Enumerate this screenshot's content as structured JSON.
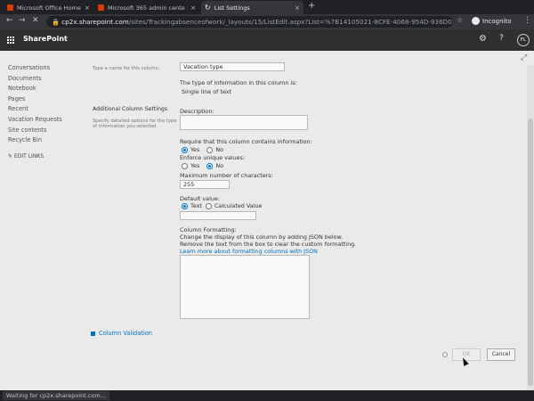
{
  "browser": {
    "tabs": [
      {
        "title": "Microsoft Office Home",
        "icon": "office-favicon",
        "color": "#d83b01"
      },
      {
        "title": "Microsoft 365 admin cente",
        "icon": "office-favicon",
        "color": "#d83b01"
      },
      {
        "title": "List Settings",
        "icon": "loading-spinner-icon",
        "color": "#bdc1c6"
      }
    ],
    "new_tab": "+",
    "url_host": "cp2x.sharepoint.com",
    "url_path": "/sites/Trackingabsenceofwork/_layouts/15/ListEdit.aspx?List=%7B14105021-8CFE-4068-954D-936D02DD4C1...",
    "incognito_label": "Incognito",
    "status_text": "Waiting for cp2x.sharepoint.com..."
  },
  "suite": {
    "brand": "SharePoint",
    "avatar_initials": "FL"
  },
  "nav": {
    "items": [
      "Conversations",
      "Documents",
      "Notebook",
      "Pages",
      "Recent",
      "Vacation Requests",
      "Site contents",
      "Recycle Bin"
    ],
    "edit_links": "EDIT LINKS"
  },
  "form": {
    "name_help": "Type a name for this column.",
    "column_name": "Vacation type",
    "type_label": "The type of information in this column is:",
    "type_value": "Single line of text",
    "additional_title": "Additional Column Settings",
    "additional_help": "Specify detailed options for the type of information you selected.",
    "description_label": "Description:",
    "require_label": "Require that this column contains information:",
    "yes": "Yes",
    "no": "No",
    "unique_label": "Enforce unique values:",
    "max_chars_label": "Maximum number of characters:",
    "max_chars_value": "255",
    "default_label": "Default value:",
    "default_text": "Text",
    "default_calc": "Calculated Value",
    "formatting_label": "Column Formatting:",
    "formatting_line1": "Change the display of this column by adding JSON below.",
    "formatting_line2": "Remove the text from the box to clear the custom formatting.",
    "formatting_link": "Learn more about formatting columns with JSON",
    "column_validation": "Column Validation",
    "ok": "OK",
    "cancel": "Cancel",
    "require_selected": "Yes",
    "unique_selected": "No",
    "default_selected": "Text"
  }
}
